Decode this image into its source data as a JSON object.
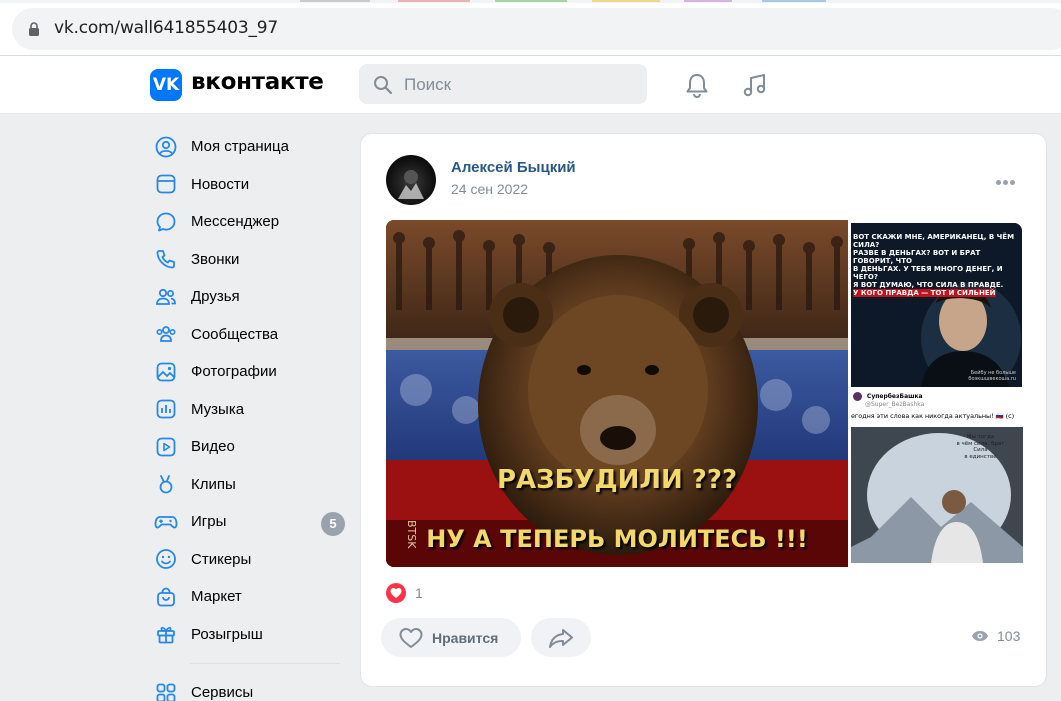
{
  "browser": {
    "url": "vk.com/wall641855403_97"
  },
  "header": {
    "logo_mark": "VK",
    "logo_text": "вконтакте",
    "search_placeholder": "Поиск",
    "icons": [
      "bell-icon",
      "music-icon"
    ]
  },
  "sidebar": {
    "items": [
      {
        "label": "Моя страница",
        "icon": "user-circle-icon"
      },
      {
        "label": "Новости",
        "icon": "news-icon"
      },
      {
        "label": "Мессенджер",
        "icon": "message-icon"
      },
      {
        "label": "Звонки",
        "icon": "phone-icon"
      },
      {
        "label": "Друзья",
        "icon": "friends-icon"
      },
      {
        "label": "Сообщества",
        "icon": "communities-icon"
      },
      {
        "label": "Фотографии",
        "icon": "photo-icon"
      },
      {
        "label": "Музыка",
        "icon": "music-bars-icon"
      },
      {
        "label": "Видео",
        "icon": "video-icon"
      },
      {
        "label": "Клипы",
        "icon": "clips-icon"
      },
      {
        "label": "Игры",
        "icon": "gamepad-icon",
        "badge": "5"
      },
      {
        "label": "Стикеры",
        "icon": "sticker-icon"
      },
      {
        "label": "Маркет",
        "icon": "bag-icon"
      },
      {
        "label": "Розыгрыш",
        "icon": "gift-icon"
      }
    ],
    "services_label": "Сервисы"
  },
  "post": {
    "author": "Алексей Быцкий",
    "date": "24 сен 2022",
    "main_image": {
      "caption_line1": "РАЗБУДИЛИ ???",
      "caption_line2": "НУ А ТЕПЕРЬ МОЛИТЕСЬ !!!",
      "side_text": "BTSK"
    },
    "side_image1": {
      "quote_lines": [
        "ВОТ СКАЖИ МНЕ, АМЕРИКАНЕЦ, В ЧЁМ СИЛА?",
        "РАЗВЕ В ДЕНЬГАХ? ВОТ И БРАТ ГОВОРИТ, ЧТО",
        "В ДЕНЬГАХ. У ТЕБЯ МНОГО ДЕНЕГ, И ЧЕГО?",
        "Я ВОТ ДУМАЮ, ЧТО СИЛА В ПРАВДЕ."
      ],
      "quote_highlight": "У КОГО ПРАВДА — ТОТ И СИЛЬНЕЙ",
      "watermark_lines": [
        "Бейбу не больше",
        "боэкшшвекоша.ru"
      ]
    },
    "side_image2": {
      "account_name": "СупербезБашка",
      "account_handle": "@Super_BezBashka",
      "tweet_text": "егодня эти слова как никогда актуальны! 🇷🇺 (с)",
      "rock_text": [
        "Мы тогда",
        "в чём сила, брат",
        "Сила",
        "в единстве"
      ]
    },
    "likes_count": "1",
    "like_button_label": "Нравится",
    "views_count": "103",
    "colors": {
      "like_red": "#ff3347",
      "link_blue": "#2a5885",
      "caption_yellow": "#f3d86b"
    }
  }
}
